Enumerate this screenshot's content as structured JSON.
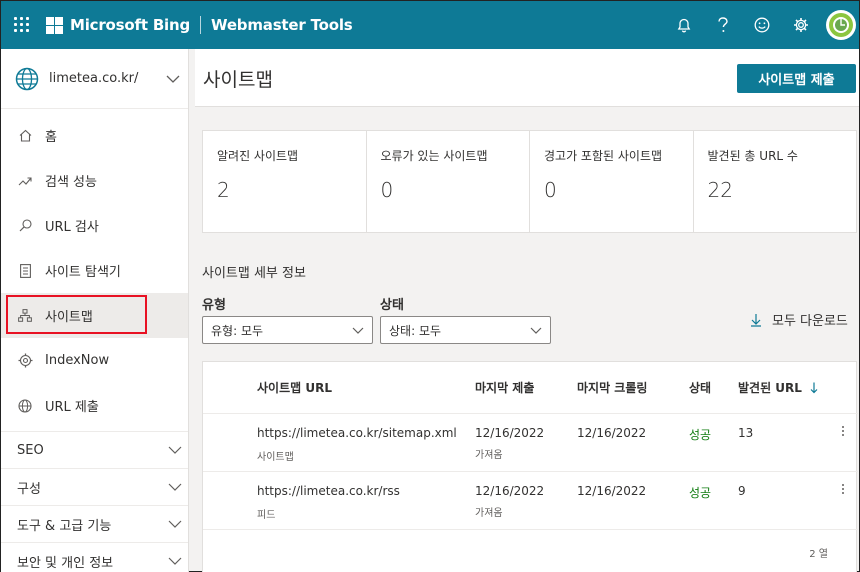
{
  "topbar": {
    "brand": "Microsoft Bing",
    "product": "Webmaster Tools",
    "icons": [
      "bell-icon",
      "help-icon",
      "smiley-icon",
      "gear-icon"
    ]
  },
  "sidebar": {
    "site": "limetea.co.kr/",
    "items": [
      {
        "label": "홈",
        "icon": "home-icon"
      },
      {
        "label": "검색 성능",
        "icon": "trend-icon"
      },
      {
        "label": "URL 검사",
        "icon": "search-icon"
      },
      {
        "label": "사이트 탐색기",
        "icon": "document-icon"
      },
      {
        "label": "사이트맵",
        "icon": "sitemap-icon"
      },
      {
        "label": "IndexNow",
        "icon": "gear-icon"
      },
      {
        "label": "URL 제출",
        "icon": "globe-icon"
      }
    ],
    "groups": [
      {
        "label": "SEO"
      },
      {
        "label": "구성"
      },
      {
        "label": "도구 & 고급 기능"
      },
      {
        "label": "보안 및 개인 정보"
      }
    ]
  },
  "main": {
    "title": "사이트맵",
    "submit_label": "사이트맵 제출",
    "stats": [
      {
        "label": "알려진 사이트맵",
        "value": "2"
      },
      {
        "label": "오류가 있는 사이트맵",
        "value": "0"
      },
      {
        "label": "경고가 포함된 사이트맵",
        "value": "0"
      },
      {
        "label": "발견된 총 URL 수",
        "value": "22"
      }
    ],
    "section_title": "사이트맵 세부 정보",
    "filters": {
      "type_label": "유형",
      "type_value": "유형: 모두",
      "status_label": "상태",
      "status_value": "상태: 모두"
    },
    "download_label": "모두 다운로드",
    "table": {
      "columns": [
        "사이트맵 URL",
        "마지막 제출",
        "마지막 크롤링",
        "상태",
        "발견된 URL"
      ],
      "rows": [
        {
          "url": "https://limetea.co.kr/sitemap.xml",
          "kind": "사이트맵",
          "submitted": "12/16/2022",
          "submitted_sub": "가져옴",
          "crawled": "12/16/2022",
          "status": "성공",
          "count": "13"
        },
        {
          "url": "https://limetea.co.kr/rss",
          "kind": "피드",
          "submitted": "12/16/2022",
          "submitted_sub": "가져옴",
          "crawled": "12/16/2022",
          "status": "성공",
          "count": "9"
        }
      ],
      "row_count": "2 열"
    },
    "colors": {
      "accent": "#0e7a96",
      "success": "#107c10",
      "highlight": "#e81123"
    }
  }
}
